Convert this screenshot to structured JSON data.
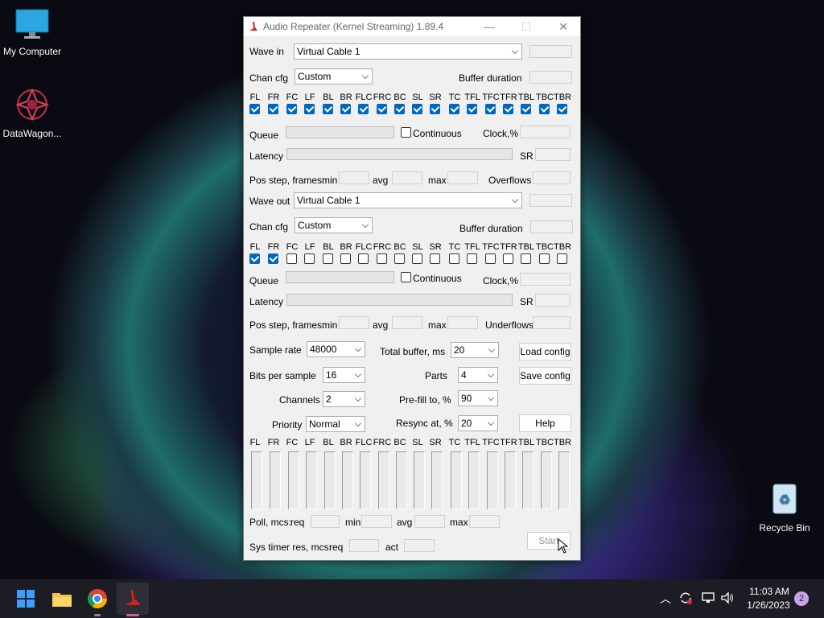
{
  "desktop": {
    "icons": [
      {
        "label": "My Computer"
      },
      {
        "label": "DataWagon..."
      },
      {
        "label": "Recycle Bin"
      }
    ]
  },
  "window": {
    "title": "Audio Repeater (Kernel Streaming) 1.89.4",
    "wave_in": {
      "label": "Wave in",
      "device": "Virtual Cable 1",
      "chan_cfg_label": "Chan cfg",
      "chan_cfg": "Custom",
      "buffer_duration_label": "Buffer duration",
      "channels_checked": [
        true,
        true,
        true,
        true,
        true,
        true,
        true,
        true,
        true,
        true,
        true,
        true,
        true,
        true,
        true,
        true,
        true,
        true
      ],
      "queue_label": "Queue",
      "continuous_label": "Continuous",
      "clock_label": "Clock,%",
      "latency_label": "Latency",
      "sr_label": "SR",
      "pos_step_label": "Pos step, frames:",
      "min_label": "min",
      "avg_label": "avg",
      "max_label": "max",
      "overflows_label": "Overflows"
    },
    "wave_out": {
      "label": "Wave out",
      "device": "Virtual Cable 1",
      "chan_cfg_label": "Chan cfg",
      "chan_cfg": "Custom",
      "buffer_duration_label": "Buffer duration",
      "channels_checked": [
        true,
        true,
        false,
        false,
        false,
        false,
        false,
        false,
        false,
        false,
        false,
        false,
        false,
        false,
        false,
        false,
        false,
        false
      ],
      "queue_label": "Queue",
      "continuous_label": "Continuous",
      "clock_label": "Clock,%",
      "latency_label": "Latency",
      "sr_label": "SR",
      "pos_step_label": "Pos step, frames:",
      "min_label": "min",
      "avg_label": "avg",
      "max_label": "max",
      "underflows_label": "Underflows"
    },
    "channel_names": [
      "FL",
      "FR",
      "FC",
      "LF",
      "BL",
      "BR",
      "FLC",
      "FRC",
      "BC",
      "SL",
      "SR",
      "TC",
      "TFL",
      "TFC",
      "TFR",
      "TBL",
      "TBC",
      "TBR"
    ],
    "settings": {
      "sample_rate_label": "Sample rate",
      "sample_rate": "48000",
      "total_buffer_label": "Total buffer, ms",
      "total_buffer": "20",
      "bits_label": "Bits per sample",
      "bits": "16",
      "parts_label": "Parts",
      "parts": "4",
      "channels_label": "Channels",
      "channels": "2",
      "prefill_label": "Pre-fill to, %",
      "prefill": "90",
      "priority_label": "Priority",
      "priority": "Normal",
      "resync_label": "Resync at, %",
      "resync": "20"
    },
    "buttons": {
      "load_config": "Load config",
      "save_config": "Save config",
      "help": "Help",
      "start": "Start"
    },
    "poll": {
      "label": "Poll, mcs:",
      "req": "req",
      "min": "min",
      "avg": "avg",
      "max": "max"
    },
    "systimer": {
      "label": "Sys timer res, mcs:",
      "req": "req",
      "act": "act"
    }
  },
  "taskbar": {
    "time": "11:03 AM",
    "date": "1/26/2023",
    "notification_count": "2",
    "apps": [
      "start-icon",
      "file-explorer-icon",
      "chrome-icon",
      "audio-repeater-icon"
    ]
  }
}
